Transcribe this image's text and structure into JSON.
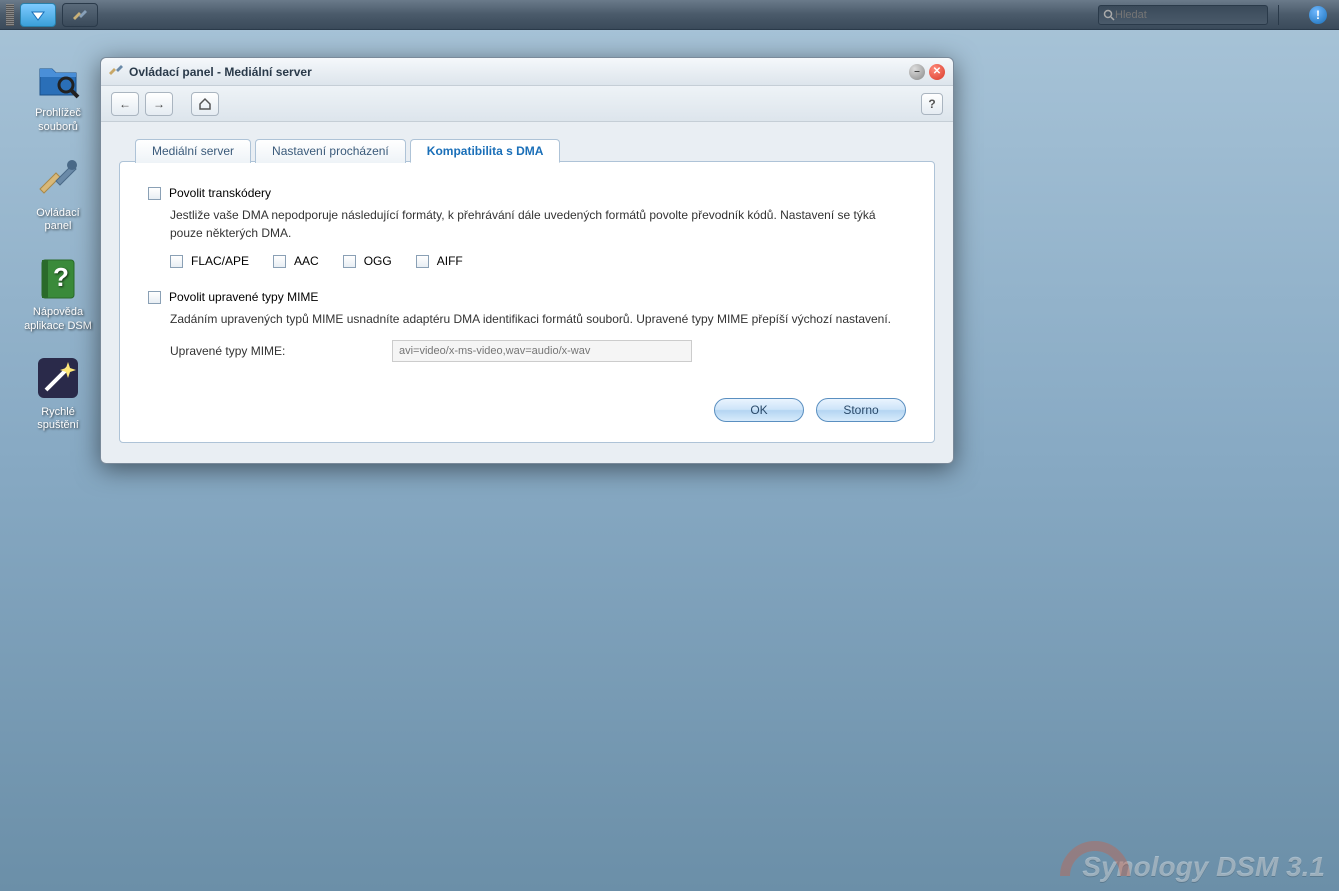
{
  "taskbar": {
    "search_placeholder": "Hledat"
  },
  "desktop": {
    "items": [
      {
        "label_line1": "Prohlížeč",
        "label_line2": "souborů"
      },
      {
        "label_line1": "Ovládací",
        "label_line2": "panel"
      },
      {
        "label_line1": "Nápověda",
        "label_line2": "aplikace DSM"
      },
      {
        "label_line1": "Rychlé",
        "label_line2": "spuštění"
      }
    ]
  },
  "window": {
    "title": "Ovládací panel - Mediální server",
    "tabs": [
      {
        "label": "Mediální server"
      },
      {
        "label": "Nastavení procházení"
      },
      {
        "label": "Kompatibilita s DMA"
      }
    ],
    "form": {
      "transcoder_label": "Povolit transkódery",
      "transcoder_desc": "Jestliže vaše DMA nepodporuje následující formáty, k přehrávání dále uvedených formátů povolte převodník kódů. Nastavení se týká pouze některých DMA.",
      "formats": [
        "FLAC/APE",
        "AAC",
        "OGG",
        "AIFF"
      ],
      "mime_label": "Povolit upravené typy MIME",
      "mime_desc": "Zadáním upravených typů MIME usnadníte adaptéru DMA identifikaci formátů souborů. Upravené typy MIME přepíší výchozí nastavení.",
      "mime_field_label": "Upravené typy MIME:",
      "mime_placeholder": "avi=video/x-ms-video,wav=audio/x-wav"
    },
    "buttons": {
      "ok": "OK",
      "cancel": "Storno"
    }
  },
  "watermark": "Synology DSM 3.1"
}
